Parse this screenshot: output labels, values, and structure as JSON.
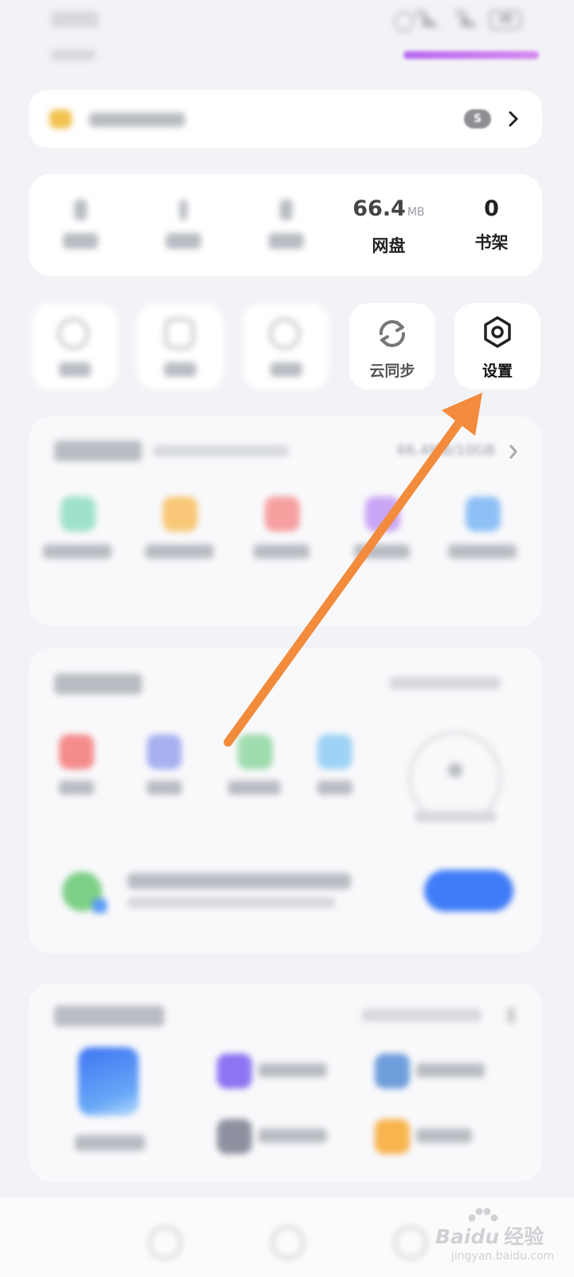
{
  "status_bar": {
    "battery": "48",
    "net_a": "4G",
    "net_b": "5G"
  },
  "stats": [
    {
      "value": "66.4",
      "unit": "MB",
      "label": "网盘"
    },
    {
      "value": "0",
      "label": "书架"
    }
  ],
  "tiles": [
    {
      "label": "云同步",
      "icon": "sync-icon"
    },
    {
      "label": "设置",
      "icon": "settings-hexagon-icon"
    }
  ],
  "storage": {
    "usage": "66.4MB/10GB"
  },
  "annotation": {
    "color": "#f28b3c"
  },
  "watermark": {
    "brand": "Baidu",
    "cn": "经验",
    "url": "jingyan.baidu.com"
  }
}
